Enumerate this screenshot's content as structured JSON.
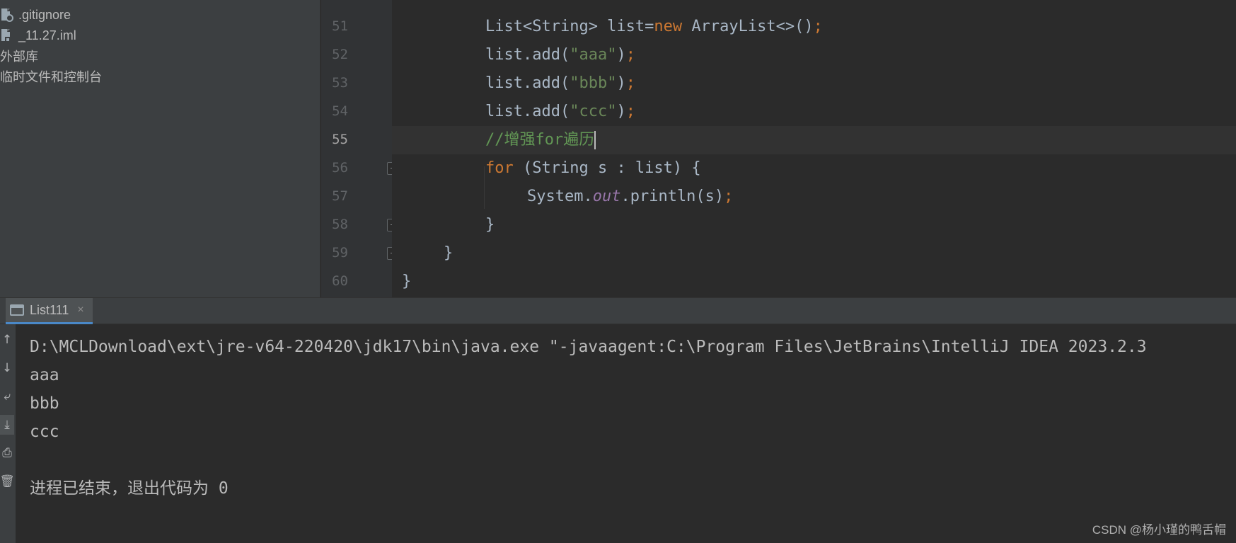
{
  "project_tree": {
    "items": [
      {
        "label": ".gitignore",
        "icon": "gitignore-file-icon"
      },
      {
        "label": "_11.27.iml",
        "icon": "iml-file-icon"
      },
      {
        "label": "外部库"
      },
      {
        "label": "临时文件和控制台"
      }
    ]
  },
  "editor": {
    "line_numbers": [
      "51",
      "52",
      "53",
      "54",
      "55",
      "56",
      "57",
      "58",
      "59",
      "60"
    ],
    "current_line": "55",
    "lines": [
      [
        "List<String> list=",
        "new",
        " ArrayList<>()",
        ";"
      ],
      [
        "list.add(",
        "\"aaa\"",
        ")",
        ";"
      ],
      [
        "list.add(",
        "\"bbb\"",
        ")",
        ";"
      ],
      [
        "list.add(",
        "\"ccc\"",
        ")",
        ";"
      ],
      [
        "//增强for遍历"
      ],
      [
        "for",
        " (String s : list) {"
      ],
      [
        "System.",
        "out",
        ".println(s)",
        ";"
      ],
      [
        "}"
      ],
      [
        "}"
      ],
      [
        "}"
      ]
    ]
  },
  "run_panel": {
    "tab_label": "List111",
    "close_label": "×",
    "toolbar": {
      "up": "↑",
      "down": "↓",
      "soft_wrap": "⤶",
      "scroll_to_end": "⤓",
      "print": "⎙",
      "clear": "🗑"
    },
    "output_lines": [
      "D:\\MCLDownload\\ext\\jre-v64-220420\\jdk17\\bin\\java.exe \"-javaagent:C:\\Program Files\\JetBrains\\IntelliJ IDEA 2023.2.3",
      "aaa",
      "bbb",
      "ccc",
      "",
      "进程已结束，退出代码为 0"
    ]
  },
  "watermark": "CSDN @杨小瑾的鸭舌帽",
  "colors": {
    "keyword": "#cc7832",
    "string": "#6a8759",
    "comment": "#629755",
    "static_field": "#9876aa",
    "text": "#a9b7c6",
    "background": "#2b2b2b"
  }
}
